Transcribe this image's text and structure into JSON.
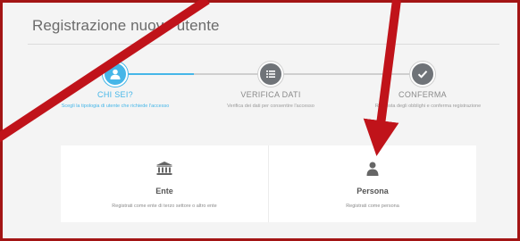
{
  "header": {
    "title": "Registrazione nuovo utente"
  },
  "steps": [
    {
      "label": "CHI SEI?",
      "description": "Scegli la tipologia di utente che richiede l'accesso",
      "icon": "user-icon",
      "active": true
    },
    {
      "label": "VERIFICA DATI",
      "description": "Verifica dei dati per consentire l'accesso",
      "icon": "list-icon",
      "active": false
    },
    {
      "label": "CONFERMA",
      "description": "Richiesta degli obblighi e conferma registrazione",
      "icon": "check-icon",
      "active": false
    }
  ],
  "options": [
    {
      "title": "Ente",
      "description": "Registrati come ente di terzo settore o altro ente",
      "icon": "institution-icon"
    },
    {
      "title": "Persona",
      "description": "Registrati come persona",
      "icon": "person-icon"
    }
  ],
  "colors": {
    "accent": "#45b6e8",
    "annotation": "#c0131a",
    "frame": "#a31515"
  }
}
